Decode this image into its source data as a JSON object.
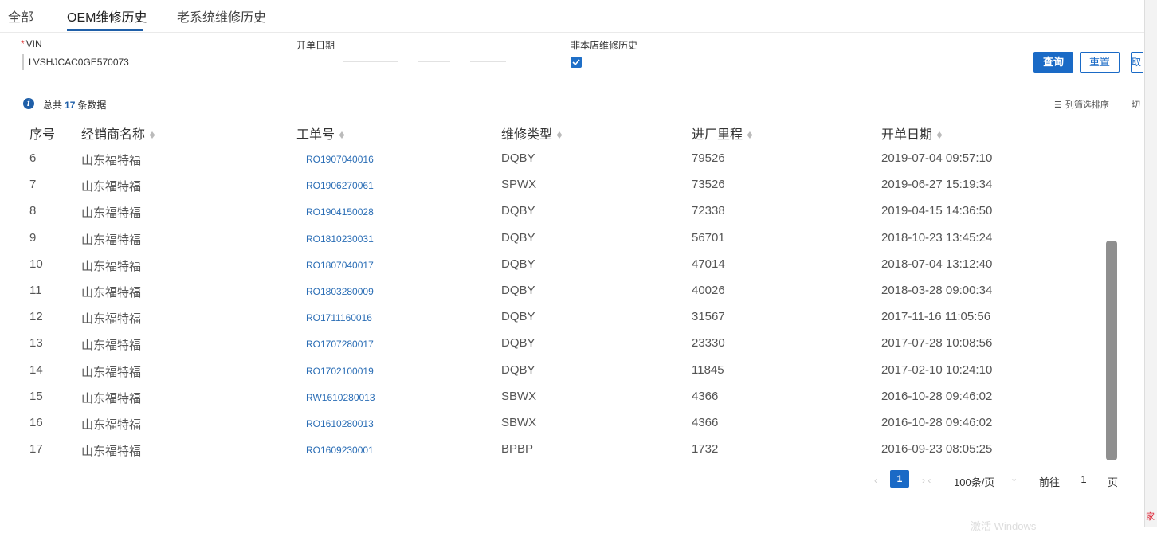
{
  "tabs": [
    {
      "label": "全部",
      "active": false
    },
    {
      "label": "OEM维修历史",
      "active": true
    },
    {
      "label": "老系统维修历史",
      "active": false
    }
  ],
  "filters": {
    "vin_required_mark": "*",
    "vin_label": "VIN",
    "vin_value": "LVSHJCAC0GE570073",
    "date_label": "开单日期",
    "other_store_label": "非本店维修历史",
    "other_store_checked": true
  },
  "buttons": {
    "query": "查询",
    "reset": "重置",
    "extra": "取"
  },
  "summary": {
    "prefix": "总共",
    "count": "17",
    "suffix": "条数据",
    "column_filter": "列筛选排序",
    "extra": "切"
  },
  "table": {
    "headers": [
      "序号",
      "经销商名称",
      "工单号",
      "维修类型",
      "进厂里程",
      "开单日期"
    ],
    "rows": [
      {
        "no": "6",
        "dealer": "山东福特福",
        "order": "RO1907040016",
        "type": "DQBY",
        "mileage": "79526",
        "date": "2019-07-04 09:57:10"
      },
      {
        "no": "7",
        "dealer": "山东福特福",
        "order": "RO1906270061",
        "type": "SPWX",
        "mileage": "73526",
        "date": "2019-06-27 15:19:34"
      },
      {
        "no": "8",
        "dealer": "山东福特福",
        "order": "RO1904150028",
        "type": "DQBY",
        "mileage": "72338",
        "date": "2019-04-15 14:36:50"
      },
      {
        "no": "9",
        "dealer": "山东福特福",
        "order": "RO1810230031",
        "type": "DQBY",
        "mileage": "56701",
        "date": "2018-10-23 13:45:24"
      },
      {
        "no": "10",
        "dealer": "山东福特福",
        "order": "RO1807040017",
        "type": "DQBY",
        "mileage": "47014",
        "date": "2018-07-04 13:12:40"
      },
      {
        "no": "11",
        "dealer": "山东福特福",
        "order": "RO1803280009",
        "type": "DQBY",
        "mileage": "40026",
        "date": "2018-03-28 09:00:34"
      },
      {
        "no": "12",
        "dealer": "山东福特福",
        "order": "RO1711160016",
        "type": "DQBY",
        "mileage": "31567",
        "date": "2017-11-16 11:05:56"
      },
      {
        "no": "13",
        "dealer": "山东福特福",
        "order": "RO1707280017",
        "type": "DQBY",
        "mileage": "23330",
        "date": "2017-07-28 10:08:56"
      },
      {
        "no": "14",
        "dealer": "山东福特福",
        "order": "RO1702100019",
        "type": "DQBY",
        "mileage": "11845",
        "date": "2017-02-10 10:24:10"
      },
      {
        "no": "15",
        "dealer": "山东福特福",
        "order": "RW1610280013",
        "type": "SBWX",
        "mileage": "4366",
        "date": "2016-10-28 09:46:02"
      },
      {
        "no": "16",
        "dealer": "山东福特福",
        "order": "RO1610280013",
        "type": "SBWX",
        "mileage": "4366",
        "date": "2016-10-28 09:46:02"
      },
      {
        "no": "17",
        "dealer": "山东福特福",
        "order": "RO1609230001",
        "type": "BPBP",
        "mileage": "1732",
        "date": "2016-09-23 08:05:25"
      }
    ]
  },
  "pagination": {
    "prev": "‹",
    "current_page": "1",
    "next": "› ‹",
    "page_size": "100条/页",
    "page_size_arrow": "⌄",
    "goto_label": "前往",
    "goto_value": "1",
    "goto_unit": "页"
  },
  "edge": {
    "text": "家"
  },
  "watermark": "激活 Windows",
  "colors": {
    "primary": "#1a6ac6",
    "link": "#2a6db5",
    "required": "#e04040"
  }
}
